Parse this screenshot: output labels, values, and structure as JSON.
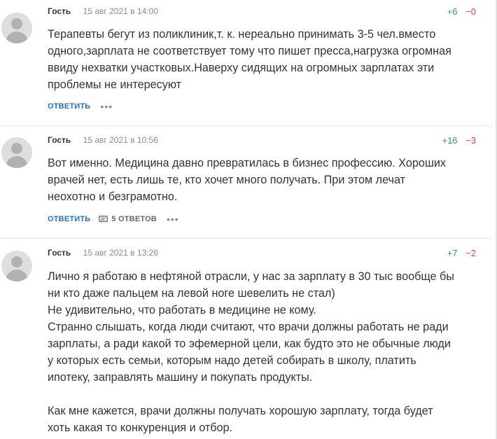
{
  "comments": [
    {
      "author": "Гость",
      "time": "15 авг 2021 в 14:00",
      "votes_up": "+6",
      "votes_down": "−0",
      "text": "Терапевты бегут из поликлиник,т. к. нереально принимать 3-5 чел.вместо\nодного,зарплата не соответствует тому что пишет пресса,нагрузка огромная\nввиду нехватки участковых.Наверху сидящих на огромных зарплатах эти\nпроблемы не интересуют",
      "reply_label": "ответить",
      "avatar_icon": "user-silhouette"
    },
    {
      "author": "Гость",
      "time": "15 авг 2021 в 10:56",
      "votes_up": "+16",
      "votes_down": "−3",
      "text": "Вот именно. Медицина давно превратилась в бизнес профессию. Хороших\nврачей нет, есть лишь те, кто хочет много получать. При этом лечат\nнеохотно и безграмотно.",
      "reply_label": "ответить",
      "replies_label": "5 ответов",
      "avatar_icon": "user-silhouette"
    },
    {
      "author": "Гость",
      "time": "15 авг 2021 в 13:26",
      "votes_up": "+7",
      "votes_down": "−2",
      "text": "Лично я работаю в нефтяной отрасли, у нас за зарплату в 30 тыс вообще бы\nни кто даже пальцем на левой ноге шевелить не стал)\nНе удивительно, что работать в медицине не кому.\nСтранно слышать, когда люди считают, что врачи должны работать не ради\nзарплаты, а ради какой то эфемерной цели, как будто это не обычные люди\nу которых есть семьи, которым надо детей собирать в школу, платить\nипотеку, заправлять машину и покупать продукты.",
      "text_2": "Как мне кажется, врачи должны получать хорошую зарплату, тогда будет\nхоть какая то конкуренция и отбор.",
      "avatar_icon": "user-silhouette"
    }
  ],
  "colors": {
    "reply_blue": "#1f72c4",
    "vote_up_green": "#2e9f47",
    "vote_down_red": "#e24242"
  }
}
